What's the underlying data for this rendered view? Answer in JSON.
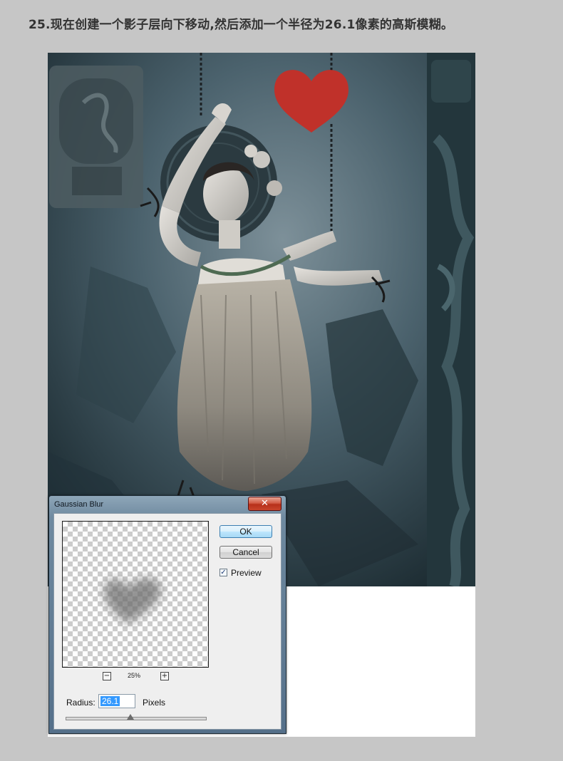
{
  "heading": "25.现在创建一个影子层向下移动,然后添加一个半径为26.1像素的高斯模糊。",
  "dialog": {
    "title": "Gaussian Blur",
    "close_glyph": "✕",
    "ok_label": "OK",
    "cancel_label": "Cancel",
    "preview_label": "Preview",
    "preview_checked": true,
    "zoom_out_glyph": "−",
    "zoom_in_glyph": "+",
    "zoom_level": "25%",
    "radius_label": "Radius:",
    "radius_value": "26.1",
    "radius_units": "Pixels",
    "radius_slider_fraction": 0.46
  },
  "colors": {
    "heart": "#c0312a",
    "wall": "#3c5560",
    "page_background": "#c6c6c6"
  }
}
